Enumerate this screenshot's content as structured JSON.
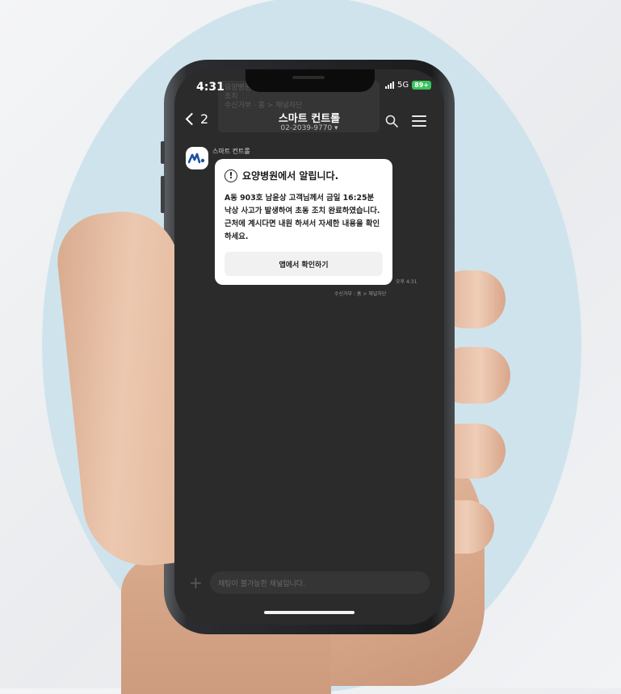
{
  "status_bar": {
    "time": "4:31",
    "network": "5G",
    "battery": "89+"
  },
  "header": {
    "title": "스마트 컨트롤",
    "phone": "02-2039-9770 ▾",
    "back_count": "2"
  },
  "background_notification": {
    "line1": "요양병원에서 알립니다 ...",
    "line2": "조치",
    "line3": "수신거부 · 홈 > 채널차단"
  },
  "message": {
    "sender": "스마트 컨트롤",
    "card_title": "요양병원에서 알립니다.",
    "card_body_lines": [
      "A동 903호 남윤상 고객님께서 금일 16:25분",
      "낙상 사고가 발생하여 초동 조치 완료하였습니다.",
      "근처에 계시다면 내원 하셔서 자세한 내용을 확인",
      "하세요."
    ],
    "button_label": "앱에서 확인하기",
    "time": "오후 4:31",
    "footer": "수신거부 : 홈 > 채널차단"
  },
  "composer": {
    "placeholder": "채팅이 불가능한 채널입니다.",
    "plus": "+"
  },
  "icons": {
    "back": "chevron-left-icon",
    "search": "search-icon",
    "menu": "hamburger-menu-icon",
    "alert": "exclamation-circle-icon",
    "avatar": "brand-logo-icon"
  },
  "colors": {
    "screen_bg": "#2b2b2b",
    "card_bg": "#ffffff",
    "background_oval": "#cfe3ec",
    "battery": "#3cc25b"
  }
}
